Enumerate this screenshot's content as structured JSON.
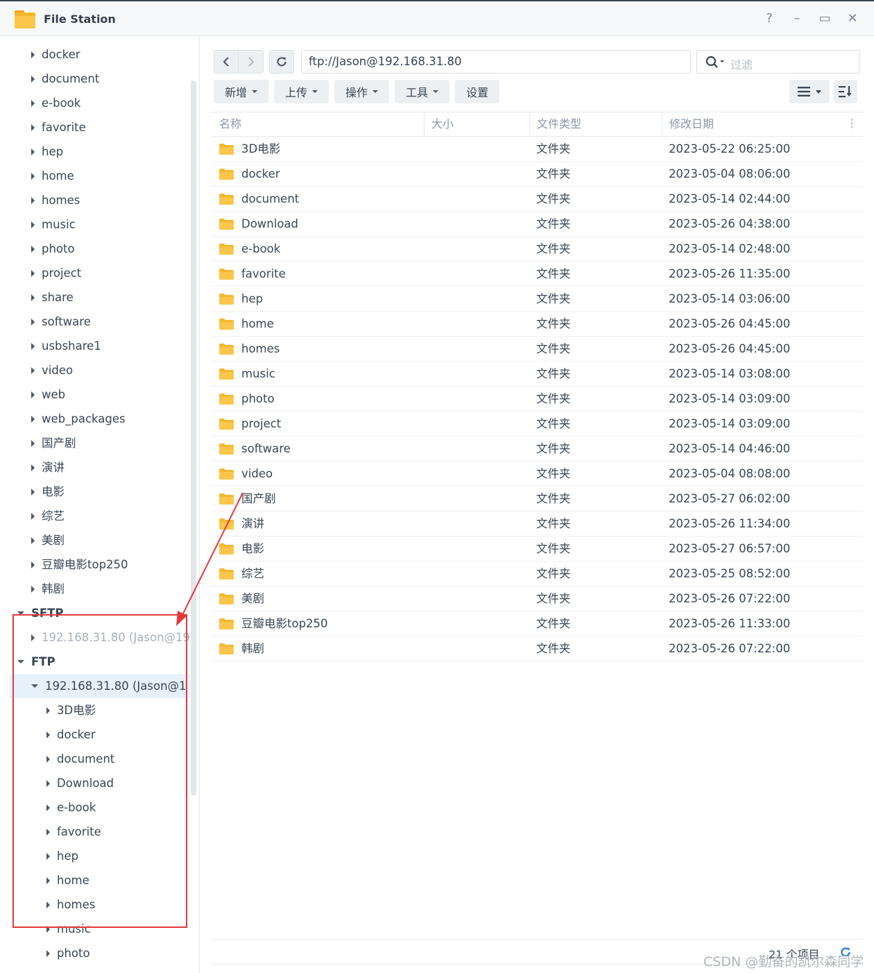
{
  "window": {
    "title": "File Station",
    "controls": [
      "?",
      "–",
      "▭",
      "✕"
    ]
  },
  "sidebar": {
    "top_items": [
      "docker",
      "document",
      "e-book",
      "favorite",
      "hep",
      "home",
      "homes",
      "music",
      "photo",
      "project",
      "share",
      "software",
      "usbshare1",
      "video",
      "web",
      "web_packages",
      "国产剧",
      "演讲",
      "电影",
      "综艺",
      "美剧",
      "豆瓣电影top250",
      "韩剧"
    ],
    "sftp_label": "SFTP",
    "sftp_server": "192.168.31.80 (Jason@19",
    "ftp_label": "FTP",
    "ftp_server": "192.168.31.80 (Jason@1",
    "ftp_children": [
      "3D电影",
      "docker",
      "document",
      "Download",
      "e-book",
      "favorite",
      "hep",
      "home",
      "homes",
      "music",
      "photo"
    ]
  },
  "address": {
    "path": "ftp://Jason@192.168.31.80",
    "filter_placeholder": "过滤"
  },
  "toolbar": {
    "create_label": "新增",
    "upload_label": "上传",
    "action_label": "操作",
    "tools_label": "工具",
    "settings_label": "设置"
  },
  "grid": {
    "columns": [
      "名称",
      "大小",
      "文件类型",
      "修改日期"
    ],
    "rows": [
      {
        "name": "3D电影",
        "type": "文件夹",
        "date": "2023-05-22 06:25:00"
      },
      {
        "name": "docker",
        "type": "文件夹",
        "date": "2023-05-04 08:06:00"
      },
      {
        "name": "document",
        "type": "文件夹",
        "date": "2023-05-14 02:44:00"
      },
      {
        "name": "Download",
        "type": "文件夹",
        "date": "2023-05-26 04:38:00"
      },
      {
        "name": "e-book",
        "type": "文件夹",
        "date": "2023-05-14 02:48:00"
      },
      {
        "name": "favorite",
        "type": "文件夹",
        "date": "2023-05-26 11:35:00"
      },
      {
        "name": "hep",
        "type": "文件夹",
        "date": "2023-05-14 03:06:00"
      },
      {
        "name": "home",
        "type": "文件夹",
        "date": "2023-05-26 04:45:00"
      },
      {
        "name": "homes",
        "type": "文件夹",
        "date": "2023-05-26 04:45:00"
      },
      {
        "name": "music",
        "type": "文件夹",
        "date": "2023-05-14 03:08:00"
      },
      {
        "name": "photo",
        "type": "文件夹",
        "date": "2023-05-14 03:09:00"
      },
      {
        "name": "project",
        "type": "文件夹",
        "date": "2023-05-14 03:09:00"
      },
      {
        "name": "software",
        "type": "文件夹",
        "date": "2023-05-14 04:46:00"
      },
      {
        "name": "video",
        "type": "文件夹",
        "date": "2023-05-04 08:08:00"
      },
      {
        "name": "国产剧",
        "type": "文件夹",
        "date": "2023-05-27 06:02:00"
      },
      {
        "name": "演讲",
        "type": "文件夹",
        "date": "2023-05-26 11:34:00"
      },
      {
        "name": "电影",
        "type": "文件夹",
        "date": "2023-05-27 06:57:00"
      },
      {
        "name": "综艺",
        "type": "文件夹",
        "date": "2023-05-25 08:52:00"
      },
      {
        "name": "美剧",
        "type": "文件夹",
        "date": "2023-05-26 07:22:00"
      },
      {
        "name": "豆瓣电影top250",
        "type": "文件夹",
        "date": "2023-05-26 11:33:00"
      },
      {
        "name": "韩剧",
        "type": "文件夹",
        "date": "2023-05-26 07:22:00"
      }
    ]
  },
  "status": {
    "item_count": "21 个项目"
  },
  "watermark": "CSDN @勤奋的凯尔森同学",
  "colors": {
    "accent": "#2f7fd6",
    "folder": "#f7b731",
    "annotation_red": "#e3393c"
  }
}
